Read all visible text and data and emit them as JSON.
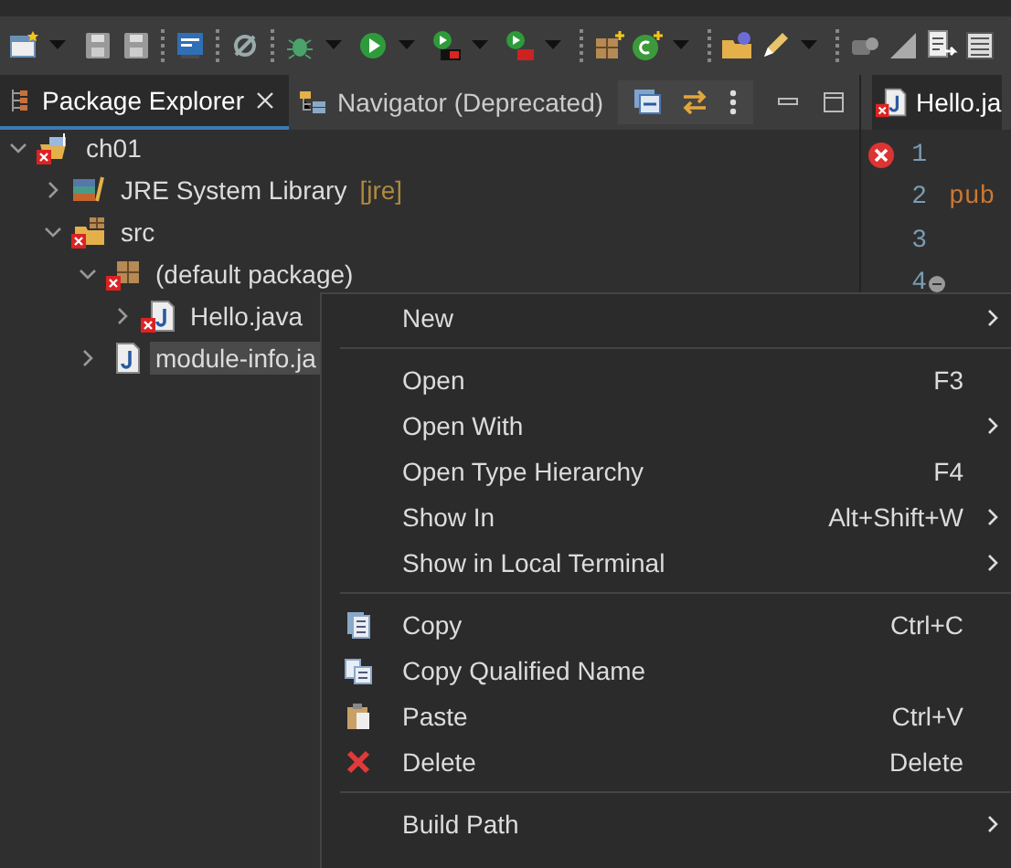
{
  "view_tabs": [
    {
      "label": "Package Explorer",
      "selected": true,
      "closable": true
    },
    {
      "label": "Navigator (Deprecated)",
      "selected": false,
      "closable": false
    }
  ],
  "tree": [
    {
      "label": "ch01",
      "kind": "project",
      "error": true,
      "expanded": true,
      "selected": false,
      "children": [
        {
          "label": "JRE System Library",
          "decoration": "[jre]",
          "kind": "library",
          "error": false,
          "expanded": false,
          "selected": false
        },
        {
          "label": "src",
          "kind": "source-folder",
          "error": true,
          "expanded": true,
          "selected": false,
          "children": [
            {
              "label": "(default package)",
              "kind": "package",
              "error": true,
              "expanded": true,
              "selected": false,
              "children": [
                {
                  "label": "Hello.java",
                  "kind": "java-file",
                  "error": true,
                  "expanded": false,
                  "selected": false
                }
              ]
            },
            {
              "label": "module-info.ja",
              "kind": "java-file",
              "error": false,
              "expanded": false,
              "selected": true
            }
          ]
        }
      ]
    }
  ],
  "editor": {
    "tab": "Hello.ja",
    "lines": [
      {
        "number": "1",
        "error": true,
        "fold": false
      },
      {
        "number": "2",
        "error": false,
        "fold": false,
        "code": "pub"
      },
      {
        "number": "3",
        "error": false,
        "fold": false
      },
      {
        "number": "4",
        "error": false,
        "fold": true
      }
    ]
  },
  "context_menu": [
    {
      "kind": "item",
      "label": "New",
      "submenu": true
    },
    {
      "kind": "separator"
    },
    {
      "kind": "item",
      "label": "Open",
      "shortcut": "F3",
      "submenu": false
    },
    {
      "kind": "item",
      "label": "Open With",
      "submenu": true
    },
    {
      "kind": "item",
      "label": "Open Type Hierarchy",
      "shortcut": "F4",
      "submenu": false
    },
    {
      "kind": "item",
      "label": "Show In",
      "shortcut": "Alt+Shift+W",
      "submenu": true
    },
    {
      "kind": "item",
      "label": "Show in Local Terminal",
      "submenu": true
    },
    {
      "kind": "separator"
    },
    {
      "kind": "item",
      "label": "Copy",
      "shortcut": "Ctrl+C",
      "submenu": false
    },
    {
      "kind": "item",
      "label": "Copy Qualified Name",
      "submenu": false
    },
    {
      "kind": "item",
      "label": "Paste",
      "shortcut": "Ctrl+V",
      "submenu": false
    },
    {
      "kind": "item",
      "label": "Delete",
      "shortcut": "Delete",
      "submenu": false
    },
    {
      "kind": "separator"
    },
    {
      "kind": "item",
      "label": "Build Path",
      "submenu": true
    }
  ]
}
